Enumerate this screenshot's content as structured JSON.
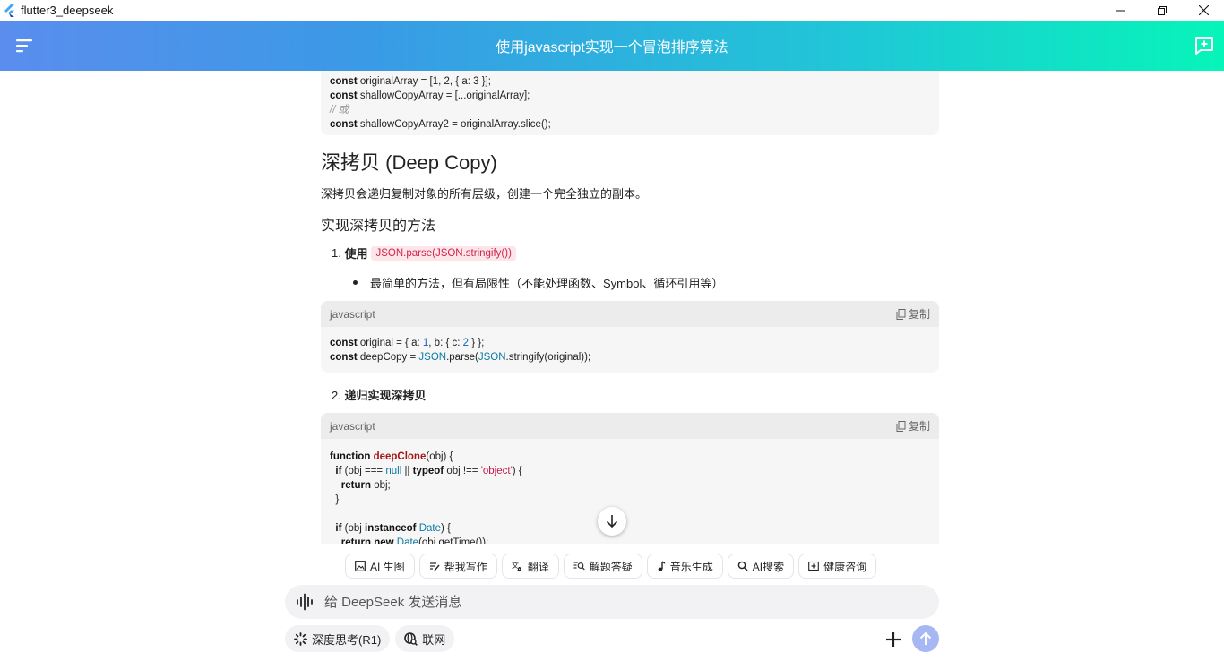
{
  "window": {
    "title": "flutter3_deepseek",
    "icon": "flutter-logo-icon"
  },
  "header": {
    "title": "使用javascript实现一个冒泡排序算法"
  },
  "content": {
    "code_top": {
      "lines": [
        "originalArray = [1, 2, { a: 3 }];",
        "shallowCopyArray = [...originalArray];",
        "// 或",
        "shallowCopyArray2 = originalArray.slice();"
      ]
    },
    "deep_copy_title": "深拷贝 (Deep Copy)",
    "deep_copy_desc": "深拷贝会递归复制对象的所有层级，创建一个完全独立的副本。",
    "methods_title": "实现深拷贝的方法",
    "item1_num": "1.",
    "item1_label": "使用",
    "item1_code": "JSON.parse(JSON.stringify())",
    "item1_bullet": "最简单的方法，但有局限性（不能处理函数、Symbol、循环引用等）",
    "code1": {
      "lang": "javascript",
      "copy": "复制"
    },
    "item2_num": "2.",
    "item2_label": "递归实现深拷贝",
    "code2": {
      "lang": "javascript",
      "copy": "复制"
    }
  },
  "tools": [
    {
      "label": "AI 生图",
      "icon": "image-icon"
    },
    {
      "label": "帮我写作",
      "icon": "writing-icon"
    },
    {
      "label": "翻译",
      "icon": "translate-icon"
    },
    {
      "label": "解题答疑",
      "icon": "question-search-icon"
    },
    {
      "label": "音乐生成",
      "icon": "music-note-icon"
    },
    {
      "label": "AI搜索",
      "icon": "search-icon"
    },
    {
      "label": "健康咨询",
      "icon": "health-icon"
    }
  ],
  "input": {
    "placeholder": "给 DeepSeek 发送消息"
  },
  "options": {
    "deep_think": "深度思考(R1)",
    "web_search": "联网"
  },
  "colors": {
    "header_start": "#5a8dee",
    "header_end": "#06f5b9",
    "send_button": "#a7b7f4",
    "inline_code_text": "#d0224c"
  }
}
